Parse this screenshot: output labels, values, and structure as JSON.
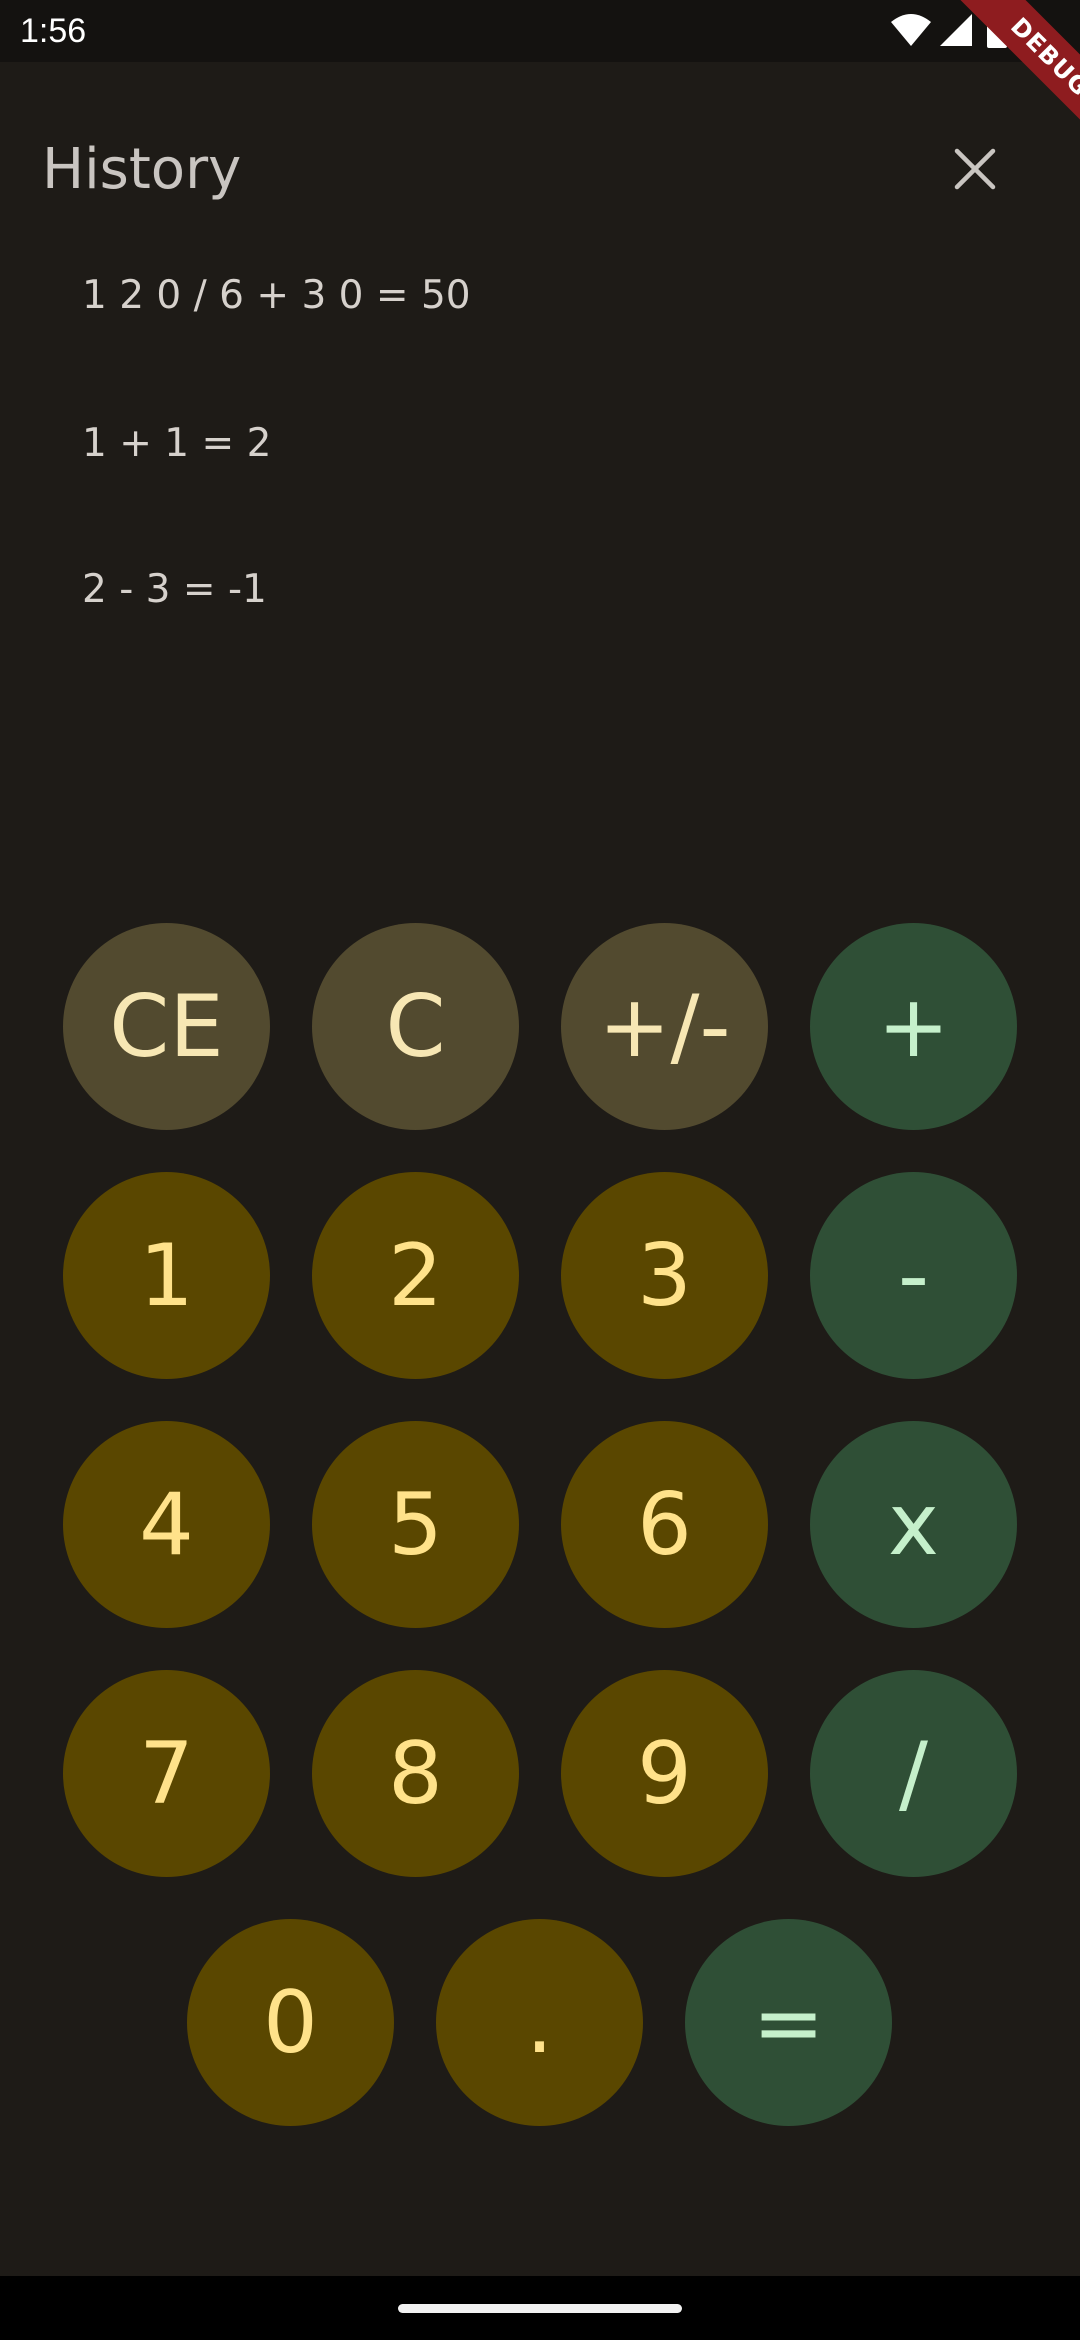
{
  "status_bar": {
    "time": "1:56",
    "icons": [
      "wifi-icon",
      "signal-icon",
      "battery-icon"
    ]
  },
  "debug_banner": {
    "label": "DEBUG"
  },
  "header": {
    "title": "History",
    "close_icon": "close-icon"
  },
  "history": {
    "items": [
      "1 2 0 / 6 + 3 0 = 50",
      "1 + 1 = 2",
      "2 - 3 = -1"
    ]
  },
  "keypad": {
    "row1": [
      "CE",
      "C",
      "+/-",
      "+"
    ],
    "row2": [
      "1",
      "2",
      "3",
      "-"
    ],
    "row3": [
      "4",
      "5",
      "6",
      "x"
    ],
    "row4": [
      "7",
      "8",
      "9",
      "/"
    ],
    "row5": [
      "0",
      ".",
      "="
    ]
  },
  "colors": {
    "background": "#1e1b17",
    "function_key": "#524a2f",
    "number_key": "#5a4700",
    "operator_key": "#2f4f36",
    "number_text": "#ffe28a",
    "operator_text": "#c5f0cb",
    "debug_ribbon": "#8e1c1f"
  }
}
